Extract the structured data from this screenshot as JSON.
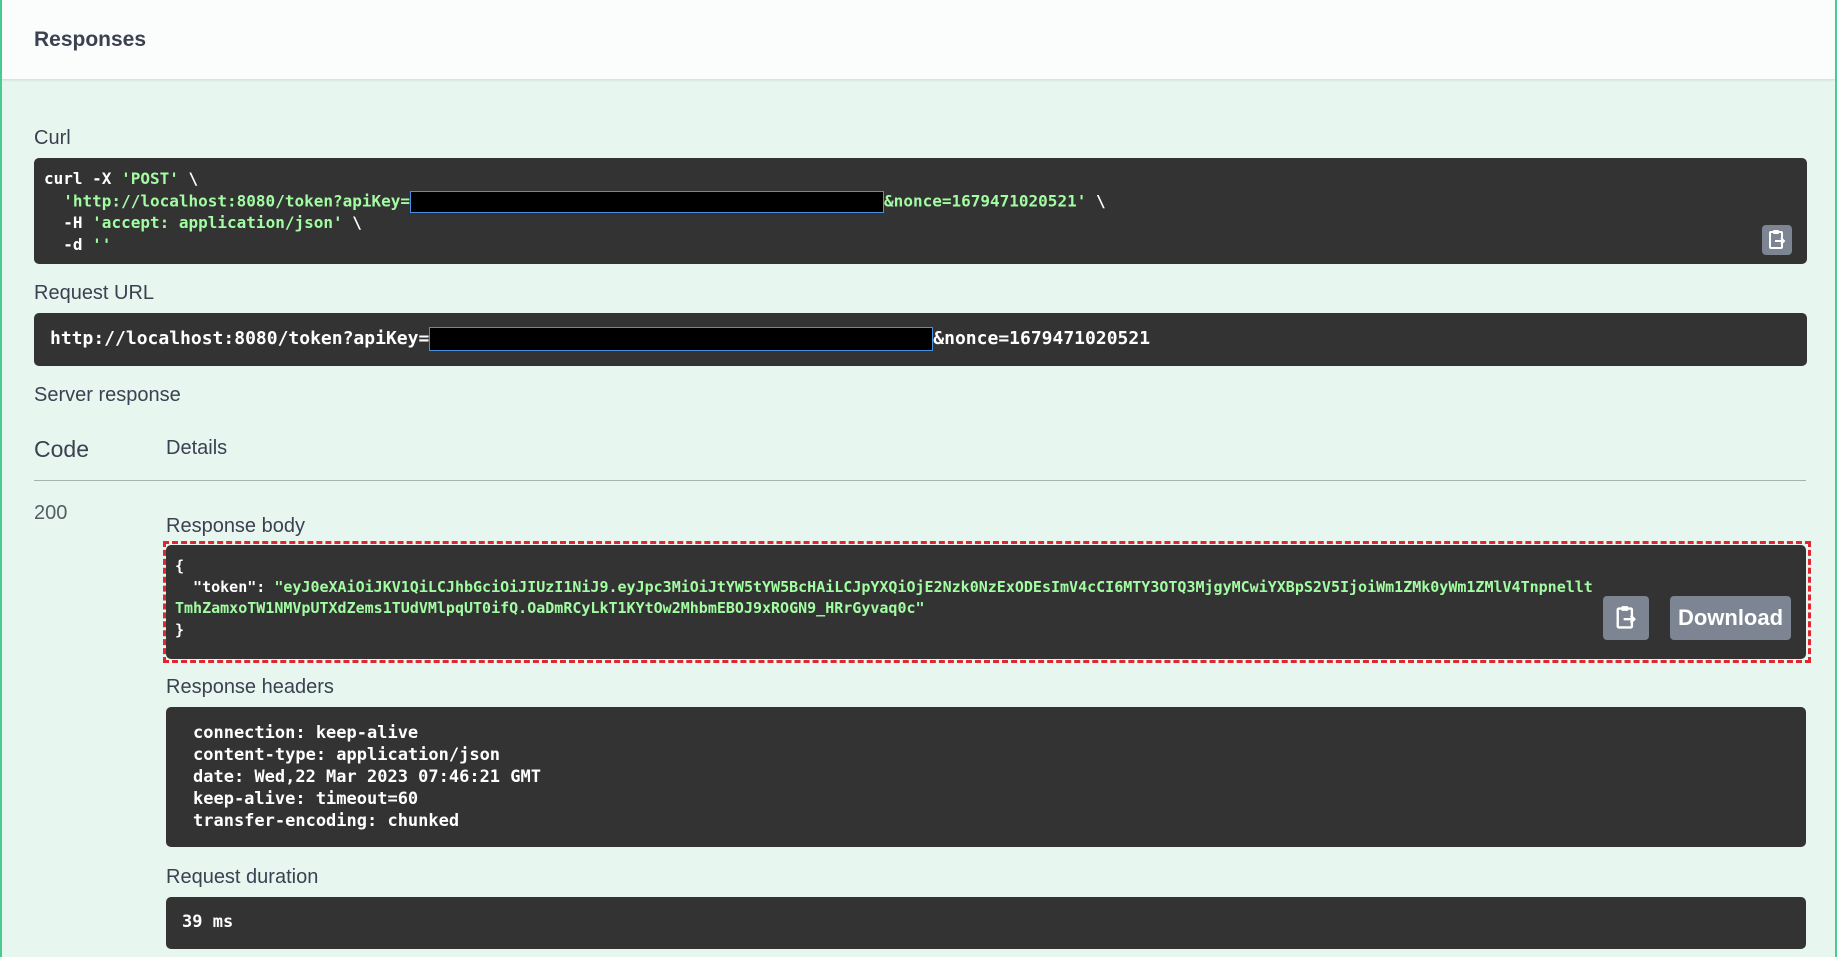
{
  "responses": {
    "title": "Responses"
  },
  "curl": {
    "label": "Curl",
    "line1_prefix": "curl -X ",
    "line1_method": "'POST'",
    "line1_suffix": " \\",
    "line2_prefix": "  'http://localhost:8080/token?apiKey=",
    "line2_suffix": "&nonce=1679471020521'",
    "line2_tail": " \\",
    "line3_prefix": "  -H ",
    "line3_value": "'accept: application/json'",
    "line3_suffix": " \\",
    "line4_prefix": "  -d ",
    "line4_value": "''"
  },
  "request_url": {
    "label": "Request URL",
    "prefix": "http://localhost:8080/token?apiKey=",
    "suffix": "&nonce=1679471020521"
  },
  "server_response": {
    "label": "Server response",
    "col_code": "Code",
    "col_details": "Details",
    "code": "200"
  },
  "response_body": {
    "label": "Response body",
    "open": "{",
    "key": "  \"token\": ",
    "value_line1": "\"eyJ0eXAiOiJKV1QiLCJhbGciOiJIUzI1NiJ9.eyJpc3MiOiJtYW5tYW5BcHAiLCJpYXQiOjE2Nzk0NzExODEsImV4cCI6MTY3OTQ3MjgyMCwiYXBpS2V5IjoiWm1ZMk0yWm1ZMlV4Tnpnellt",
    "value_line2": "TmhZamxoTW1NMVpUTXdZems1TUdVMlpqUT0ifQ.OaDmRCyLkT1KYtOw2MhbmEBOJ9xROGN9_HRrGyvaq0c\"",
    "close": "}",
    "download_label": "Download"
  },
  "response_headers": {
    "label": "Response headers",
    "lines": [
      "connection: keep-alive",
      "content-type: application/json",
      "date: Wed,22 Mar 2023 07:46:21 GMT",
      "keep-alive: timeout=60",
      "transfer-encoding: chunked"
    ]
  },
  "request_duration": {
    "label": "Request duration",
    "value": "39 ms"
  },
  "icons": {
    "copy": "clipboard-copy-icon"
  },
  "colors": {
    "accent": "#49cc90",
    "string": "#a2fca2",
    "highlight": "#e0262f"
  }
}
